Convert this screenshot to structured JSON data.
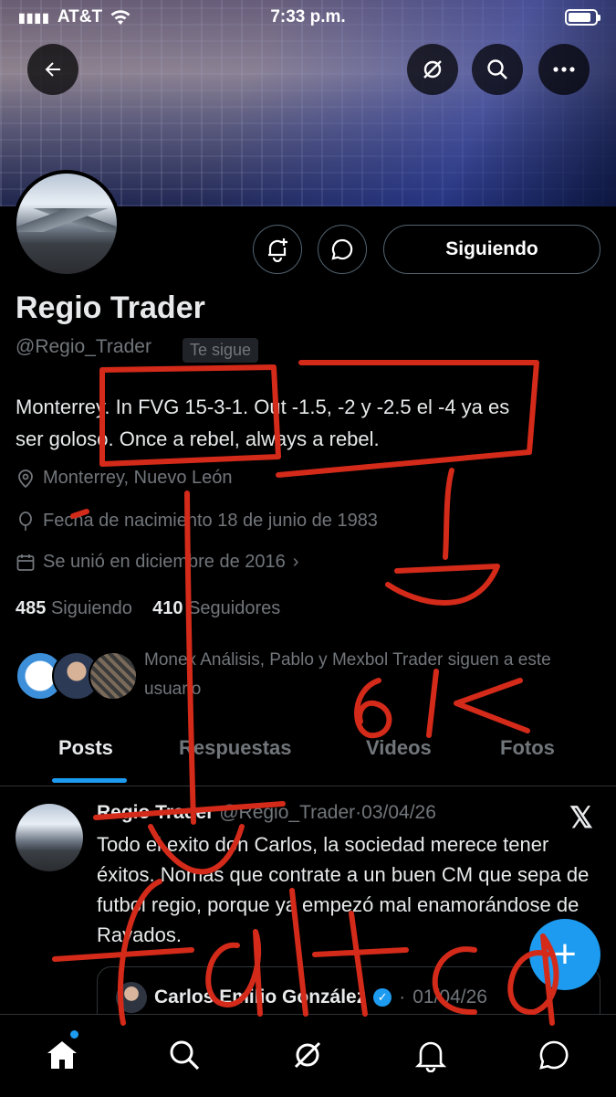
{
  "status_bar": {
    "carrier": "AT&T",
    "time": "7:33 p.m."
  },
  "header_buttons": {
    "back": "arrow-left-icon",
    "grok": "grok-icon",
    "search": "search-icon",
    "more": "more-icon"
  },
  "profile": {
    "name": "Regio Trader",
    "handle": "@Regio_Trader",
    "follows_you": "Te sigue",
    "follow_button": "Siguiendo",
    "bio_line1": "Monterrey. In FVG 15-3-1. Out -1.5, -2 y -2.5 el -4 ya es",
    "bio_line2": "ser goloso. Once a rebel, always a rebel.",
    "location": "Monterrey, Nuevo León",
    "birthday": "Fecha de nacimiento 18 de junio de 1983",
    "joined": "Se unió en diciembre de 2016",
    "following_count": "485",
    "following_label": "Siguiendo",
    "followers_count": "410",
    "followers_label": "Seguidores",
    "followed_by": "Monex Análisis, Pablo y Mexbol Trader siguen a este usuario"
  },
  "tabs": [
    "Posts",
    "Respuestas",
    "Videos",
    "Fotos"
  ],
  "post": {
    "author": "Regio Trader",
    "handle": "@Regio_Trader",
    "separator": "·",
    "date": "03/04/26",
    "text": "Todo el exito don Carlos, la sociedad merece tener éxitos. Nomas que contrate a un buen CM que sepa de futbol regio, porque ya empezó mal enamorándose de Rayados.",
    "quote_author": "Carlos Emilio González",
    "quote_separator": "·",
    "quote_date": "01/04/26"
  },
  "annotations": {
    "note1": "6K",
    "note2": "falta"
  },
  "colors": {
    "accent": "#1d9bf0",
    "annotation": "#d42a1a",
    "background": "#000000"
  }
}
